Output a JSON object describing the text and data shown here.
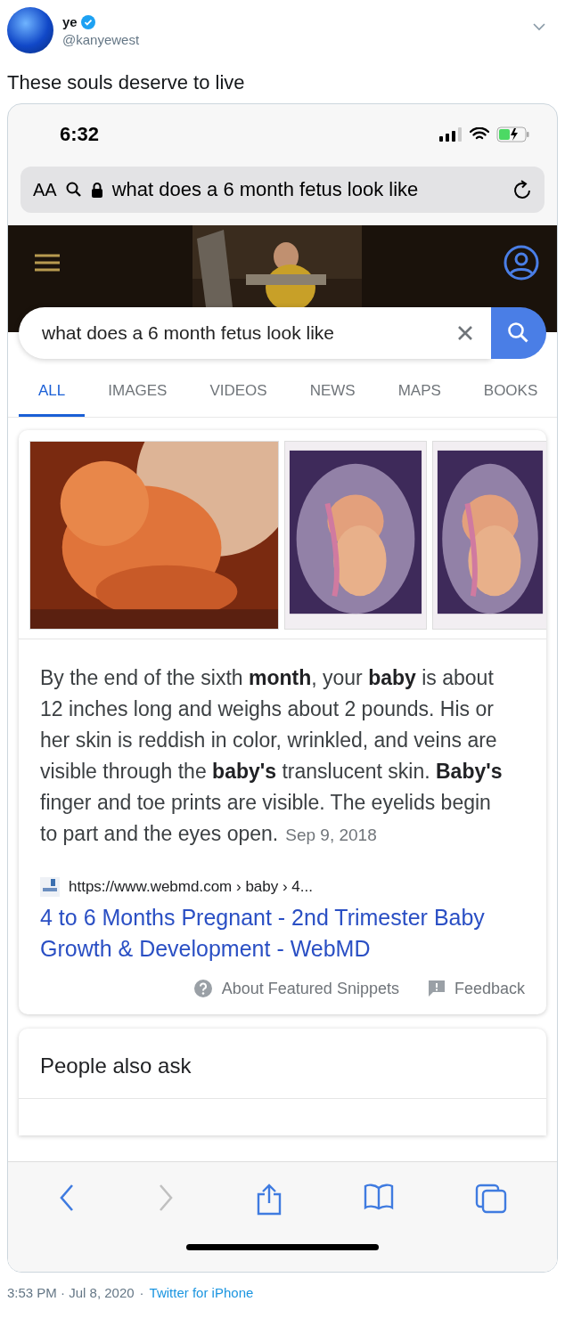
{
  "tweet": {
    "display_name": "ye",
    "verified": true,
    "handle": "@kanyewest",
    "text": "These souls deserve to live",
    "timestamp": "3:53 PM · Jul 8, 2020",
    "separator": "·",
    "source": "Twitter for iPhone"
  },
  "phone": {
    "status_bar": {
      "time": "6:32"
    },
    "address_bar": {
      "text_size": "AA",
      "url": "what does a 6 month fetus look like"
    },
    "search": {
      "value": "what does a 6 month fetus look like"
    },
    "tabs": [
      {
        "label": "ALL",
        "selected": true
      },
      {
        "label": "IMAGES",
        "selected": false
      },
      {
        "label": "VIDEOS",
        "selected": false
      },
      {
        "label": "NEWS",
        "selected": false
      },
      {
        "label": "MAPS",
        "selected": false
      },
      {
        "label": "BOOKS",
        "selected": false
      }
    ],
    "snippet": {
      "text": "By the end of the sixth **month**, your **baby** is about 12 inches long and weighs about 2 pounds. His or her skin is reddish in color, wrinkled, and veins are visible through the **baby's** translucent skin. **Baby's** finger and toe prints are visible. The eyelids begin to part and the eyes open.",
      "date": "Sep 9, 2018",
      "source_url": "https://www.webmd.com › baby › 4...",
      "title": "4 to 6 Months Pregnant - 2nd Trimester Baby Growth & Development - WebMD",
      "about": "About Featured Snippets",
      "feedback": "Feedback"
    },
    "people_also_ask": {
      "title": "People also ask"
    }
  }
}
